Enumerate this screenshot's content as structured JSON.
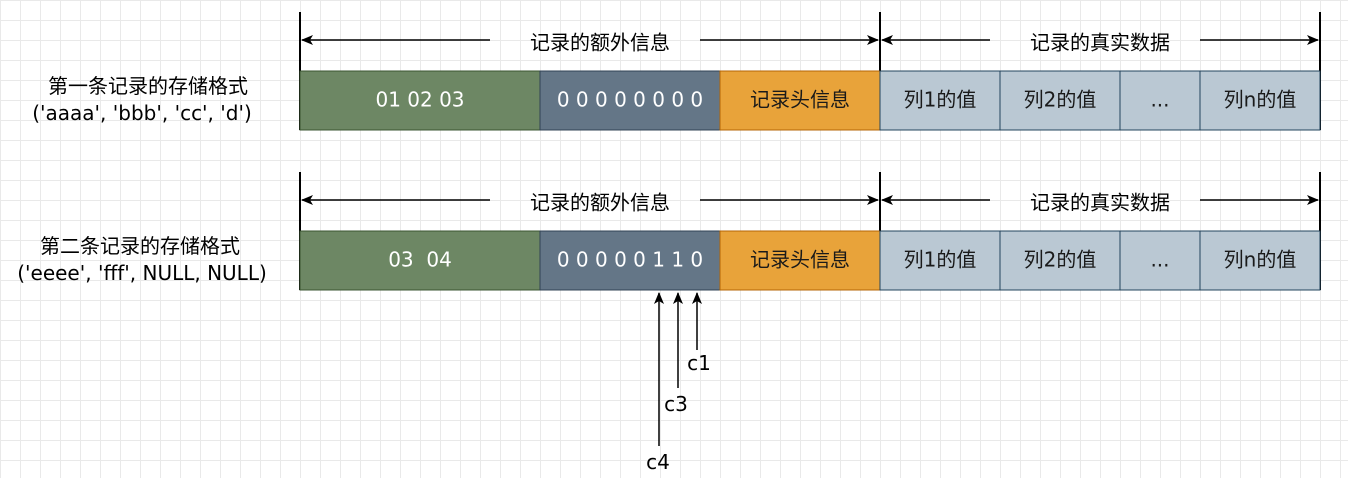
{
  "rows": [
    {
      "title": "第一条记录的存储格式",
      "values": "('aaaa', 'bbb', 'cc', 'd')",
      "extra_info_label": "记录的额外信息",
      "real_data_label": "记录的真实数据",
      "segments": {
        "var_len": "01 02 03",
        "null_list": "0 0 0 0 0 0 0 0",
        "header": "记录头信息",
        "col1": "列1的值",
        "col2": "列2的值",
        "ellipsis": "...",
        "coln": "列n的值"
      }
    },
    {
      "title": "第二条记录的存储格式",
      "values": "('eeee', 'fff', NULL, NULL)",
      "extra_info_label": "记录的额外信息",
      "real_data_label": "记录的真实数据",
      "segments": {
        "var_len": "03  04",
        "null_list": "0 0 0 0 0 1 1 0",
        "header": "记录头信息",
        "col1": "列1的值",
        "col2": "列2的值",
        "ellipsis": "...",
        "coln": "列n的值"
      }
    }
  ],
  "pointers": [
    "c1",
    "c3",
    "c4"
  ],
  "colors": {
    "var_len": "#6d8764",
    "null_list": "#647687",
    "header": "#e8a33a",
    "column": "#bac8d3",
    "border": "#314354"
  }
}
